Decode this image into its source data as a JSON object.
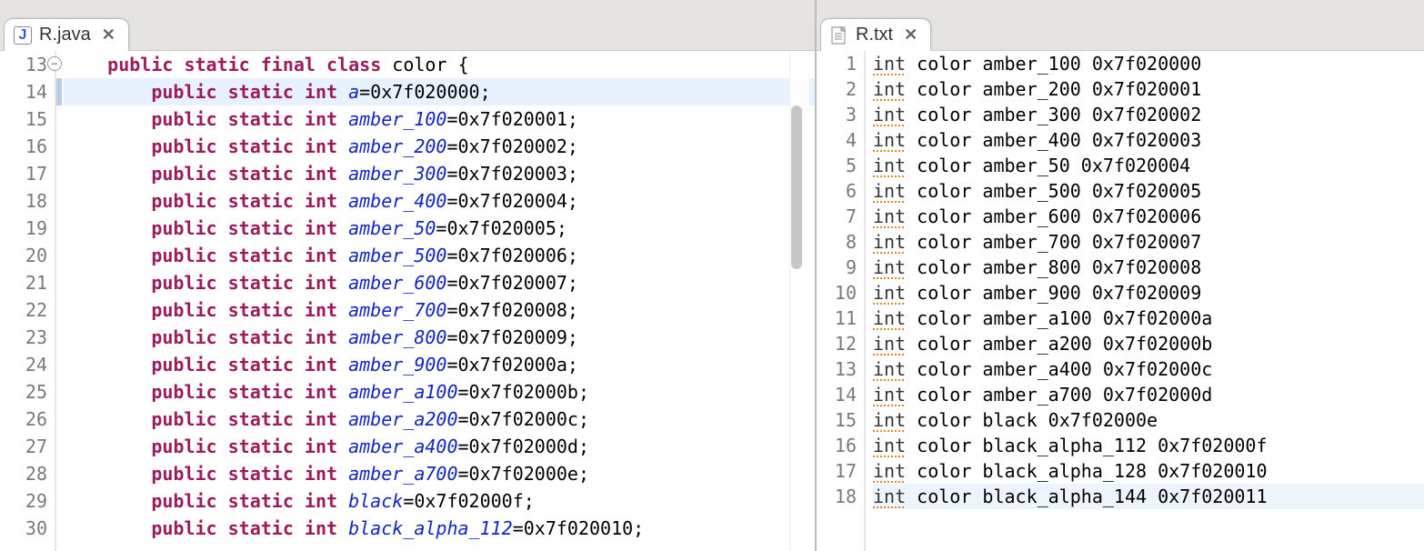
{
  "left": {
    "tab_label": "R.java",
    "first_line_number": 13,
    "class_decl": {
      "prefix": "public static final class ",
      "name": "color",
      "suffix": " {"
    },
    "fields": [
      {
        "name": "a",
        "value": "0x7f020000"
      },
      {
        "name": "amber_100",
        "value": "0x7f020001"
      },
      {
        "name": "amber_200",
        "value": "0x7f020002"
      },
      {
        "name": "amber_300",
        "value": "0x7f020003"
      },
      {
        "name": "amber_400",
        "value": "0x7f020004"
      },
      {
        "name": "amber_50",
        "value": "0x7f020005"
      },
      {
        "name": "amber_500",
        "value": "0x7f020006"
      },
      {
        "name": "amber_600",
        "value": "0x7f020007"
      },
      {
        "name": "amber_700",
        "value": "0x7f020008"
      },
      {
        "name": "amber_800",
        "value": "0x7f020009"
      },
      {
        "name": "amber_900",
        "value": "0x7f02000a"
      },
      {
        "name": "amber_a100",
        "value": "0x7f02000b"
      },
      {
        "name": "amber_a200",
        "value": "0x7f02000c"
      },
      {
        "name": "amber_a400",
        "value": "0x7f02000d"
      },
      {
        "name": "amber_a700",
        "value": "0x7f02000e"
      },
      {
        "name": "black",
        "value": "0x7f02000f"
      },
      {
        "name": "black_alpha_112",
        "value": "0x7f020010"
      }
    ],
    "field_prefix": "public static int ",
    "current_line": 14
  },
  "right": {
    "tab_label": "R.txt",
    "lines": [
      {
        "int": "int",
        "rest": " color amber_100 0x7f020000"
      },
      {
        "int": "int",
        "rest": " color amber_200 0x7f020001"
      },
      {
        "int": "int",
        "rest": " color amber_300 0x7f020002"
      },
      {
        "int": "int",
        "rest": " color amber_400 0x7f020003"
      },
      {
        "int": "int",
        "rest": " color amber_50 0x7f020004"
      },
      {
        "int": "int",
        "rest": " color amber_500 0x7f020005"
      },
      {
        "int": "int",
        "rest": " color amber_600 0x7f020006"
      },
      {
        "int": "int",
        "rest": " color amber_700 0x7f020007"
      },
      {
        "int": "int",
        "rest": " color amber_800 0x7f020008"
      },
      {
        "int": "int",
        "rest": " color amber_900 0x7f020009"
      },
      {
        "int": "int",
        "rest": " color amber_a100 0x7f02000a"
      },
      {
        "int": "int",
        "rest": " color amber_a200 0x7f02000b"
      },
      {
        "int": "int",
        "rest": " color amber_a400 0x7f02000c"
      },
      {
        "int": "int",
        "rest": " color amber_a700 0x7f02000d"
      },
      {
        "int": "int",
        "rest": " color black 0x7f02000e"
      },
      {
        "int": "int",
        "rest": " color black_alpha_112 0x7f02000f"
      },
      {
        "int": "int",
        "rest": " color black_alpha_128 0x7f020010"
      },
      {
        "int": "int",
        "rest": " color black_alpha_144 0x7f020011"
      }
    ],
    "hover_line": 18
  }
}
